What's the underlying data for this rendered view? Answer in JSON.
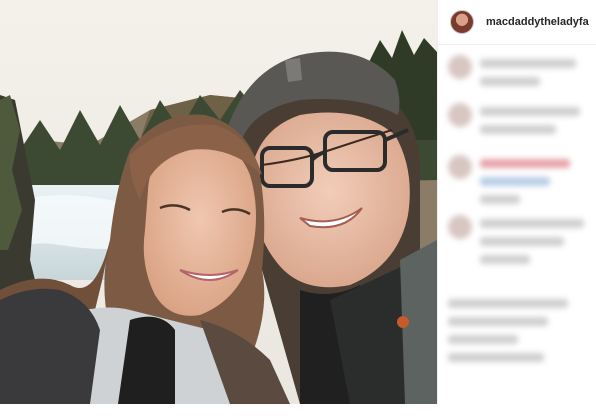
{
  "post": {
    "username": "macdaddytheladyfa",
    "image_alt": "selfie photo",
    "avatar_icon": "profile-avatar"
  },
  "colors": {
    "username_text": "#262626",
    "divider": "#efefef",
    "blur_gray": "#cfcfcf",
    "blur_red": "#e6a3a8",
    "blur_blue": "#b9cde6"
  }
}
